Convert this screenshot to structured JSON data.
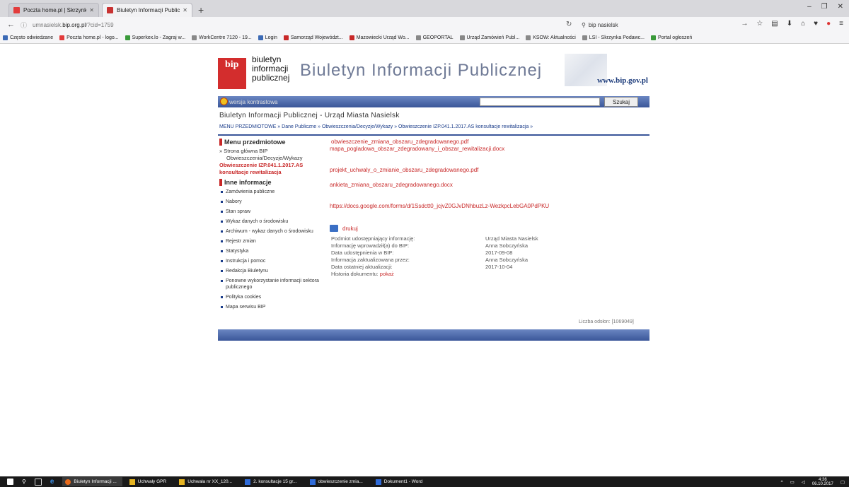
{
  "browser": {
    "tabs": [
      {
        "title": "Poczta home.pl | Skrzynka o",
        "active": false
      },
      {
        "title": "Biuletyn Informacji Publiczn",
        "active": true
      }
    ],
    "new_tab": "+",
    "url_host": "umnasielsk.",
    "url_domain": "bip.org.pl",
    "url_path": "/?cid=1759",
    "search_value": "bip nasielsk",
    "bookmarks": [
      "Często odwiedzane",
      "Poczta home.pl - logo...",
      "Superkex.lo - Zagraj w...",
      "WorkCentre 7120 - 19...",
      "Login",
      "Samorząd Województ...",
      "Mazowiecki Urząd Wo...",
      "GEOPORTAL",
      "Urząd Zamówień Publ...",
      "KSOW: Aktualności",
      "LSI - Skrzynka Podawc...",
      "Portal ogłoszeń"
    ]
  },
  "header": {
    "logo_bip": "bip",
    "logo_line1": "biuletyn",
    "logo_line2": "informacji",
    "logo_line3": "publicznej",
    "title": "Biuletyn Informacji Publicznej",
    "url": "www.bip.gov.pl"
  },
  "topbar": {
    "contrast": "wersja kontrastowa",
    "search_button": "Szukaj"
  },
  "site_title": "Biuletyn Informacji Publicznej - Urząd Miasta Nasielsk",
  "breadcrumb": "MENU PRZEDMIOTOWE » Dane Publiczne » Obwieszczenia/Decyzje/Wykazy » Obwieszczenie IZP.041.1.2017.AS konsultacje rewitalizacja »",
  "sidebar": {
    "menu_heading": "Menu przedmiotowe",
    "home": "» Strona główna BIP",
    "sub": "Obwieszczenia/Decyzje/Wykazy",
    "current_line1": "Obwieszczenie IZP.041.1.2017.AS",
    "current_line2": "konsultacje rewitalizacja",
    "info_heading": "Inne informacje",
    "items": [
      "Zamówienia publiczne",
      "Nabory",
      "Stan spraw",
      "Wykaz danych o środowisku",
      "Archiwum - wykaz danych o środowisku",
      "Rejestr zmian",
      "Statystyka",
      "Instrukcja i pomoc",
      "Redakcja Biuletynu",
      "Ponowne wykorzystanie informacji sektora publicznego",
      "Polityka cookies",
      "Mapa serwisu BIP"
    ]
  },
  "content": {
    "files": [
      "obwieszczenie_zmiana_obszaru_zdegradowanego.pdf",
      "mapa_pogladowa_obszar_zdegradowany_i_obszar_rewitalizacji.docx",
      "projekt_uchwaly_o_zmianie_obszaru_zdegradowanego.pdf",
      "ankieta_zmiana_obszaru_zdegradowanego.docx",
      "https://docs.google.com/forms/d/1Ssdctt0_jcjvZ0GJvDNhbuzLz-WezkpcLebGA0PdPKU"
    ],
    "print": "drukuj",
    "meta": [
      {
        "k": "Podmiot udostępniający informację:",
        "v": "Urząd Miasta Nasielsk"
      },
      {
        "k": "Informację wprowadził(a) do BIP:",
        "v": "Anna Sobczyńska"
      },
      {
        "k": "Data udostępnienia w BIP:",
        "v": "2017-09-08"
      },
      {
        "k": "Informacja zaktualizowana przez:",
        "v": "Anna Sobczyńska"
      },
      {
        "k": "Data ostatniej aktualizacji:",
        "v": "2017-10-04"
      }
    ],
    "history_label": "Historia dokumentu:",
    "history_link": "pokaż"
  },
  "counter": "Liczba odsłon: [1069049]",
  "taskbar": {
    "items": [
      {
        "label": "Biuletyn Informacji ...",
        "active": true
      },
      {
        "label": "Uchwały GPR",
        "active": false
      },
      {
        "label": "Uchwała nr XX_120...",
        "active": false
      },
      {
        "label": "2. konsultacje 15 gr...",
        "active": false
      },
      {
        "label": "obwieszczenie zmia...",
        "active": false
      },
      {
        "label": "Dokument1 - Word",
        "active": false
      }
    ],
    "time": "4:36",
    "date": "06.10.2017"
  }
}
